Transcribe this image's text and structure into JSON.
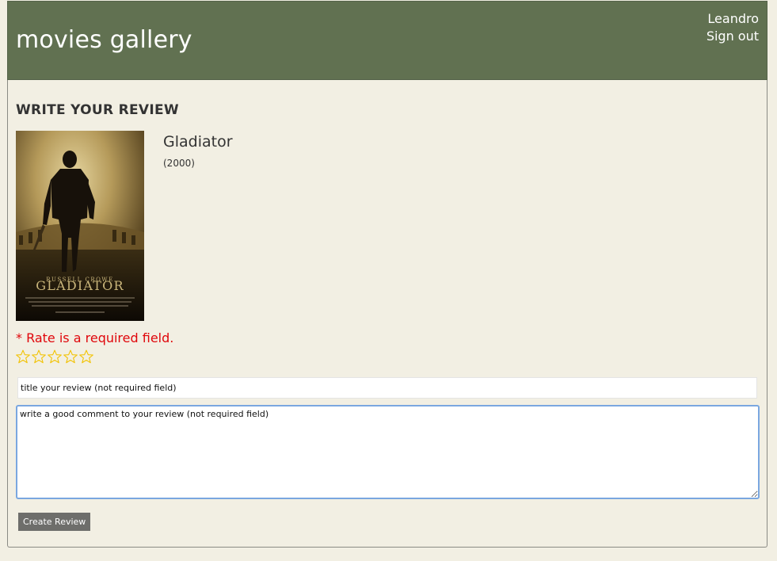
{
  "header": {
    "brand": "movies gallery",
    "user_name": "Leandro",
    "sign_out": "Sign out"
  },
  "review": {
    "heading": "WRITE YOUR REVIEW",
    "movie_title": "Gladiator",
    "movie_year": "(2000)",
    "poster": {
      "actor": "RUSSELL CROWE",
      "title": "GLADIATOR"
    },
    "rate_error": "* Rate is a required field.",
    "stars_total": 5,
    "stars_selected": 0,
    "title_placeholder": "title your review (not required field)",
    "comment_placeholder": "write a good comment to your review (not required field)",
    "submit_label": "Create Review"
  },
  "colors": {
    "header_bg": "#617151",
    "page_bg": "#f2efe3",
    "error": "#e0060b",
    "star": "#f2c200",
    "focus": "#7aa7e0",
    "button_bg": "#6e6e6b"
  }
}
